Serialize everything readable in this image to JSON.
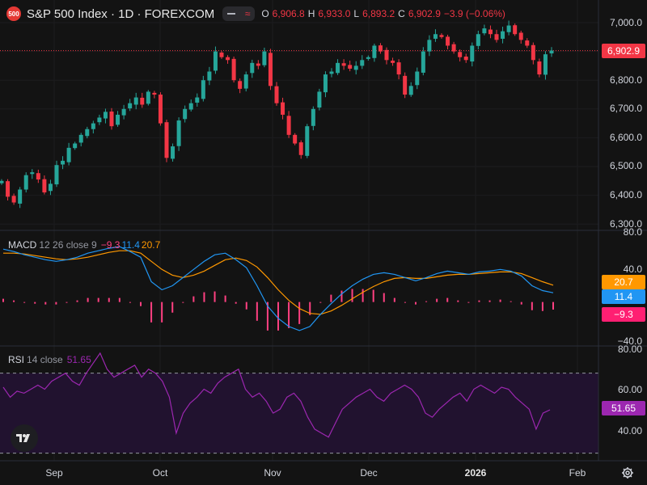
{
  "header": {
    "symbol_badge": "500",
    "title": "S&P 500 Index · 1D · FOREXCOM",
    "o_label": "O",
    "o_value": "6,906.8",
    "h_label": "H",
    "h_value": "6,933.0",
    "l_label": "L",
    "l_value": "6,893.2",
    "c_label": "C",
    "c_value": "6,902.9",
    "change": "−3.9 (−0.06%)"
  },
  "price_axis": {
    "ticks": [
      "7,000.0",
      "6,900.0",
      "6,800.0",
      "6,700.0",
      "6,600.0",
      "6,500.0",
      "6,400.0",
      "6,300.0"
    ],
    "last_price_label": "6,902.9",
    "last_price": 6902.9
  },
  "macd": {
    "name": "MACD",
    "params": "12 26 close 9",
    "macd_value": "−9.3",
    "signal_value": "11.4",
    "histogram_value": "20.7",
    "axis_ticks": [
      "80.0",
      "40.0",
      "−40.0"
    ],
    "tag_orange": "20.7",
    "tag_blue": "11.4",
    "tag_pink": "−9.3"
  },
  "rsi": {
    "name": "RSI",
    "params": "14 close",
    "value": "51.65",
    "axis_ticks": [
      "80.00",
      "60.00",
      "40.00"
    ],
    "tag": "51.65",
    "upper_band": 70,
    "lower_band": 30
  },
  "time_axis": {
    "labels": [
      {
        "text": "Sep",
        "bold": false
      },
      {
        "text": "Oct",
        "bold": false
      },
      {
        "text": "Nov",
        "bold": false
      },
      {
        "text": "Dec",
        "bold": false
      },
      {
        "text": "2026",
        "bold": true
      },
      {
        "text": "Feb",
        "bold": false
      }
    ]
  },
  "icons": {
    "logo": "tradingview-logo-icon",
    "settings": "gear-icon",
    "visibility": "minus-icon",
    "wave": "wave-icon"
  },
  "colors": {
    "up": "#26a69a",
    "down": "#f23645",
    "macd_line": "#2196f3",
    "signal_line": "#ff9800",
    "histogram": "#ff4081",
    "rsi_line": "#9c27b0",
    "rsi_band_fill": "#21122f"
  },
  "chart_data": [
    {
      "type": "candlestick",
      "title": "S&P 500 Index · 1D · FOREXCOM",
      "ylim": [
        6275,
        7040
      ],
      "y_ticks": [
        7000,
        6900,
        6800,
        6700,
        6600,
        6500,
        6400,
        6300
      ],
      "x_months": [
        "Sep",
        "Oct",
        "Nov",
        "Dec",
        "2026",
        "Feb"
      ],
      "close_path": [
        6450,
        6395,
        6375,
        6420,
        6470,
        6480,
        6455,
        6410,
        6440,
        6505,
        6520,
        6565,
        6580,
        6610,
        6630,
        6650,
        6670,
        6690,
        6640,
        6680,
        6700,
        6720,
        6740,
        6715,
        6760,
        6750,
        6650,
        6530,
        6570,
        6660,
        6700,
        6720,
        6740,
        6800,
        6830,
        6900,
        6880,
        6870,
        6800,
        6770,
        6820,
        6860,
        6850,
        6900,
        6780,
        6720,
        6680,
        6610,
        6580,
        6540,
        6640,
        6700,
        6760,
        6820,
        6830,
        6860,
        6850,
        6840,
        6850,
        6870,
        6880,
        6920,
        6900,
        6870,
        6860,
        6820,
        6750,
        6780,
        6830,
        6900,
        6940,
        6960,
        6950,
        6920,
        6900,
        6880,
        6870,
        6920,
        6960,
        6980,
        6960,
        6940,
        6970,
        6990,
        6960,
        6940,
        6920,
        6870,
        6820,
        6890,
        6903
      ],
      "last": 6902.9
    },
    {
      "type": "line",
      "name": "MACD 12 26 close 9",
      "ylim": [
        -48,
        86
      ],
      "series": [
        {
          "name": "MACD",
          "values": [
            65,
            62,
            58,
            55,
            52,
            50,
            52,
            55,
            60,
            63,
            66,
            68,
            62,
            55,
            25,
            15,
            20,
            30,
            40,
            50,
            58,
            60,
            52,
            42,
            20,
            -5,
            -20,
            -30,
            -35,
            -30,
            -15,
            -2,
            10,
            20,
            28,
            34,
            36,
            34,
            30,
            26,
            30,
            35,
            38,
            36,
            34,
            37,
            38,
            40,
            38,
            32,
            20,
            14,
            11.4
          ]
        },
        {
          "name": "Signal",
          "values": [
            60,
            60,
            59,
            57,
            55,
            53,
            52,
            53,
            55,
            58,
            61,
            63,
            63,
            60,
            50,
            40,
            33,
            30,
            33,
            38,
            45,
            52,
            54,
            51,
            43,
            30,
            15,
            2,
            -8,
            -14,
            -15,
            -11,
            -4,
            4,
            12,
            19,
            25,
            29,
            30,
            29,
            29,
            31,
            33,
            34,
            34,
            35,
            36,
            37,
            37,
            35,
            30,
            25,
            20.7
          ]
        },
        {
          "name": "Histogram",
          "values": [
            4,
            2,
            -1,
            -2,
            -3,
            -3,
            0,
            2,
            5,
            5,
            5,
            5,
            -1,
            -5,
            -25,
            -25,
            -13,
            0,
            7,
            12,
            13,
            8,
            -2,
            -9,
            -23,
            -35,
            -35,
            -32,
            -27,
            -16,
            0,
            9,
            14,
            16,
            16,
            15,
            11,
            5,
            0,
            -3,
            1,
            4,
            5,
            2,
            0,
            2,
            2,
            3,
            1,
            -3,
            -10,
            -11,
            -9.3
          ]
        }
      ],
      "last": {
        "macd": 11.4,
        "signal": 20.7,
        "histogram": -9.3
      }
    },
    {
      "type": "line",
      "name": "RSI 14 close",
      "ylim": [
        27,
        82
      ],
      "bands": [
        30,
        70
      ],
      "values": [
        63,
        58,
        61,
        60,
        62,
        64,
        62,
        66,
        68,
        70,
        66,
        64,
        70,
        75,
        80,
        72,
        68,
        70,
        72,
        74,
        68,
        72,
        70,
        66,
        58,
        40,
        50,
        55,
        58,
        62,
        60,
        65,
        68,
        70,
        72,
        62,
        58,
        60,
        56,
        50,
        52,
        58,
        60,
        56,
        48,
        42,
        40,
        38,
        45,
        52,
        55,
        58,
        60,
        62,
        58,
        56,
        60,
        62,
        64,
        62,
        58,
        50,
        48,
        52,
        55,
        58,
        60,
        56,
        62,
        64,
        62,
        60,
        63,
        62,
        58,
        55,
        52,
        42,
        50,
        51.65
      ],
      "last": 51.65
    }
  ]
}
